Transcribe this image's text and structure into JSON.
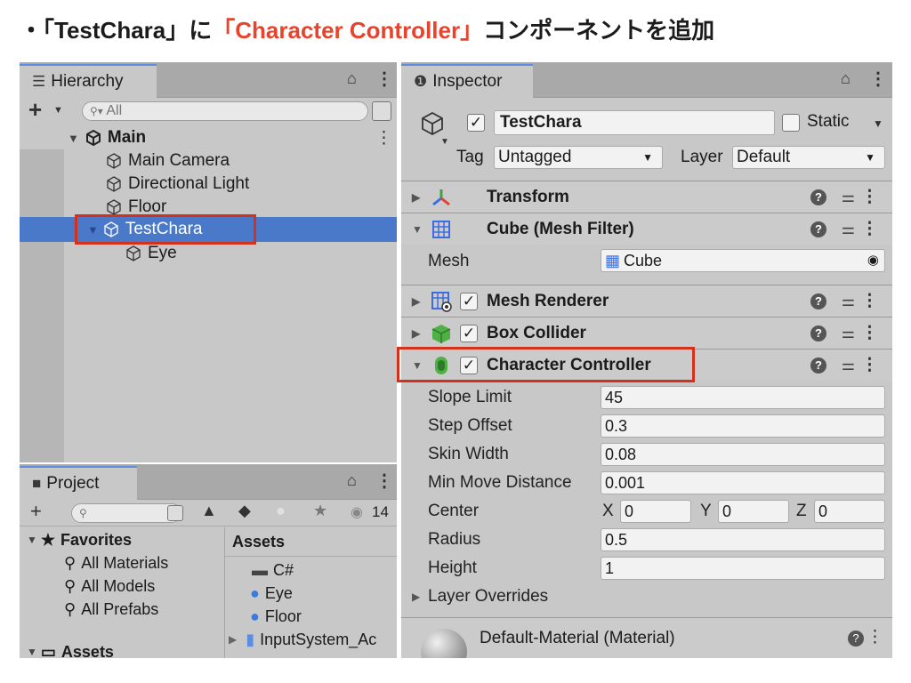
{
  "title": {
    "bullet": "・",
    "part1": "「TestChara」に",
    "part2": "「Character Controller」",
    "part3": "コンポーネントを追加"
  },
  "colors": {
    "highlight": "#e8432d",
    "selection": "#4a79c9",
    "annotation_box": "#d4311d"
  },
  "hierarchy": {
    "tab_label": "Hierarchy",
    "search_placeholder": "All",
    "add_label": "+",
    "tree": [
      {
        "label": "Main",
        "depth": 0,
        "bold": true,
        "expanded": true
      },
      {
        "label": "Main Camera",
        "depth": 1
      },
      {
        "label": "Directional Light",
        "depth": 1
      },
      {
        "label": "Floor",
        "depth": 1
      },
      {
        "label": "TestChara",
        "depth": 1,
        "selected": true,
        "expanded": true
      },
      {
        "label": "Eye",
        "depth": 2
      }
    ]
  },
  "project": {
    "tab_label": "Project",
    "add_label": "+",
    "count": "14",
    "favorites_label": "Favorites",
    "favorites": [
      "All Materials",
      "All Models",
      "All Prefabs"
    ],
    "assets_root_label": "Assets",
    "assets_header": "Assets",
    "assets": [
      {
        "label": "C#",
        "icon": "folder-icon"
      },
      {
        "label": "Eye",
        "icon": "material-ball-icon"
      },
      {
        "label": "Floor",
        "icon": "material-ball-icon"
      },
      {
        "label": "InputSystem_Ac",
        "icon": "input-actions-icon"
      }
    ]
  },
  "inspector": {
    "tab_label": "Inspector",
    "object_name": "TestChara",
    "static_label": "Static",
    "tag_label": "Tag",
    "tag_value": "Untagged",
    "layer_label": "Layer",
    "layer_value": "Default",
    "components": {
      "transform": "Transform",
      "mesh_filter": "Cube (Mesh Filter)",
      "mesh_label": "Mesh",
      "mesh_value": "Cube",
      "mesh_renderer": "Mesh Renderer",
      "box_collider": "Box Collider",
      "character_controller": "Character Controller"
    },
    "cc_props": {
      "slope_limit_label": "Slope Limit",
      "slope_limit": "45",
      "step_offset_label": "Step Offset",
      "step_offset": "0.3",
      "skin_width_label": "Skin Width",
      "skin_width": "0.08",
      "min_move_label": "Min Move Distance",
      "min_move": "0.001",
      "center_label": "Center",
      "center_x_label": "X",
      "center_x": "0",
      "center_y_label": "Y",
      "center_y": "0",
      "center_z_label": "Z",
      "center_z": "0",
      "radius_label": "Radius",
      "radius": "0.5",
      "height_label": "Height",
      "height": "1",
      "layer_overrides_label": "Layer Overrides"
    },
    "material_label": "Default-Material (Material)"
  }
}
